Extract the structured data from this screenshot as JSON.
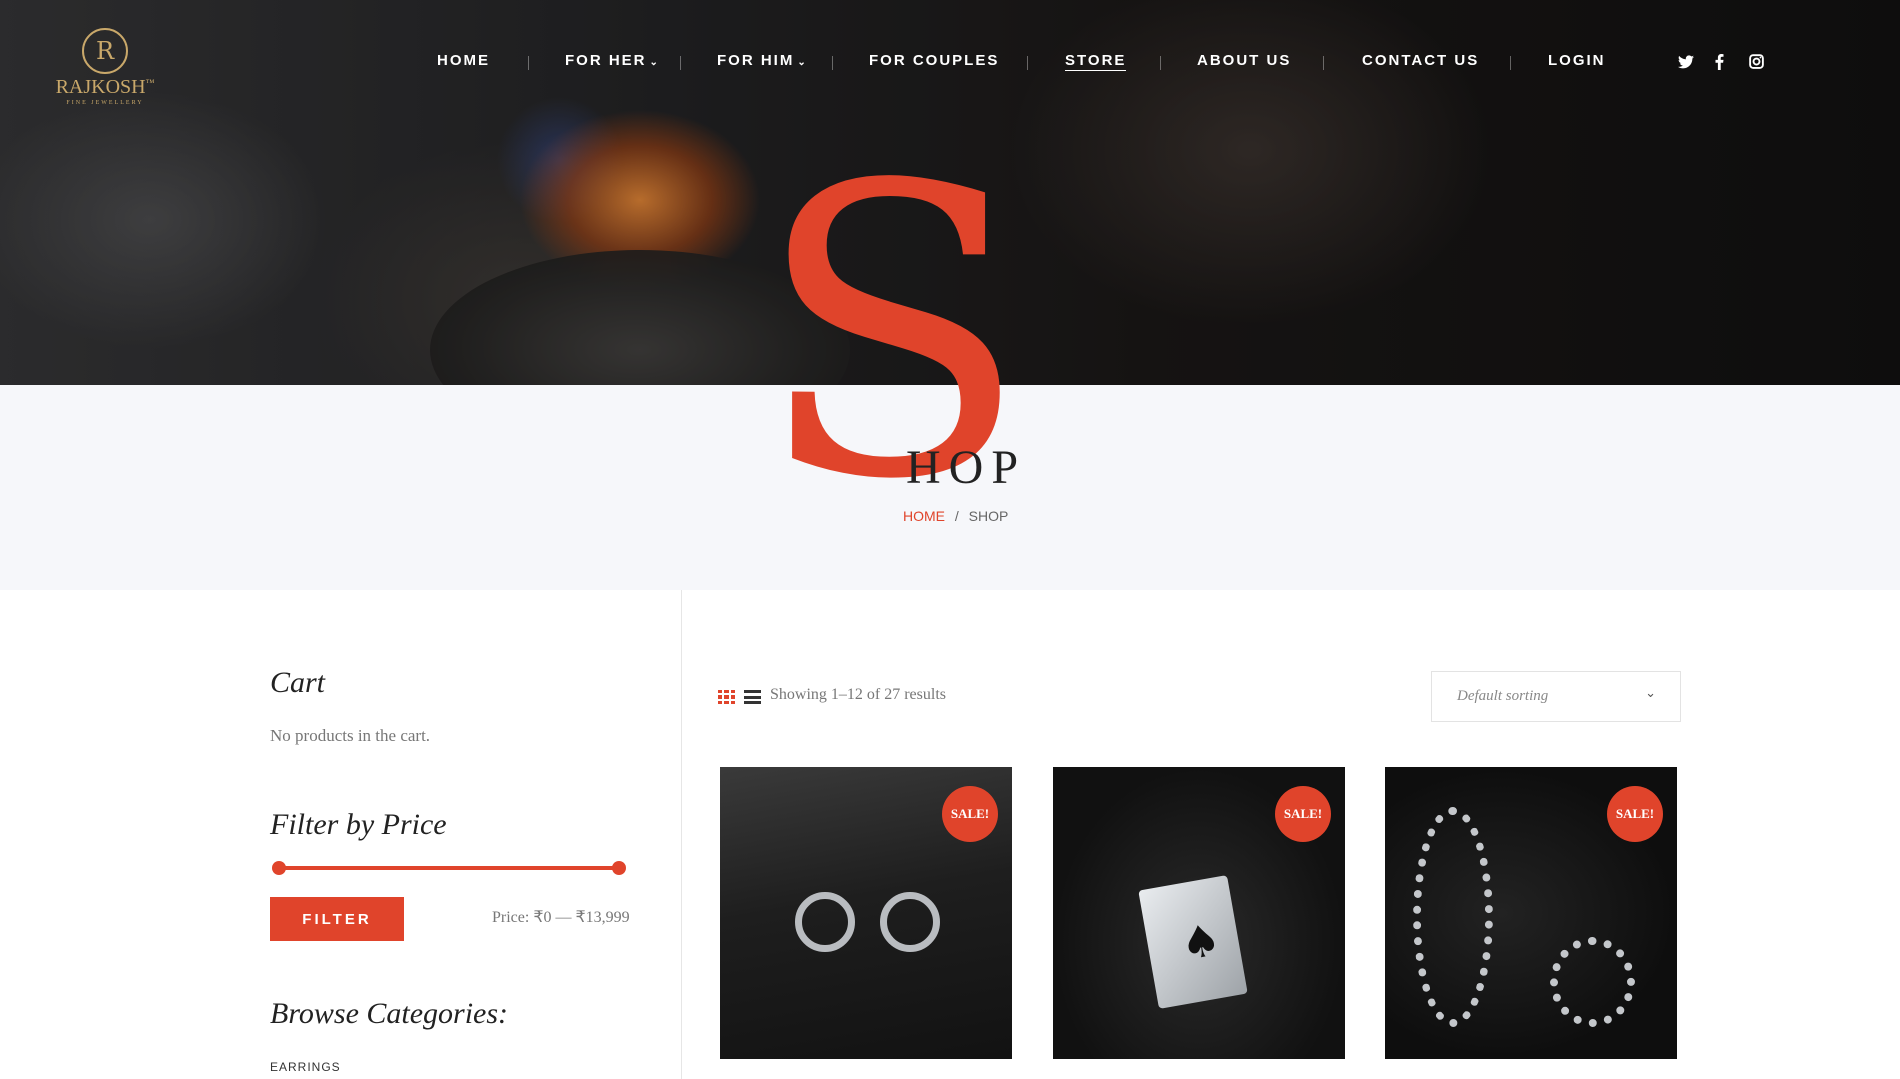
{
  "brand": {
    "name": "RAJKOSH",
    "mark": "R",
    "tm": "™",
    "tagline": "FINE JEWELLERY"
  },
  "nav": {
    "items": [
      {
        "label": "HOME"
      },
      {
        "label": "FOR HER",
        "dropdown": true
      },
      {
        "label": "FOR HIM",
        "dropdown": true
      },
      {
        "label": "FOR COUPLES"
      },
      {
        "label": "STORE",
        "active": true
      },
      {
        "label": "ABOUT US"
      },
      {
        "label": "CONTACT US"
      },
      {
        "label": "LOGIN"
      }
    ],
    "social": [
      "twitter-icon",
      "facebook-icon",
      "instagram-icon"
    ]
  },
  "page": {
    "title_initial": "S",
    "title_rest": "HOP",
    "breadcrumb": {
      "home": "HOME",
      "separator": "/",
      "current": "SHOP"
    }
  },
  "sidebar": {
    "cart": {
      "title": "Cart",
      "empty_text": "No products in the cart."
    },
    "price_filter": {
      "title": "Filter by Price",
      "button": "FILTER",
      "label": "Price: ₹0 — ₹13,999",
      "min": 0,
      "max": 13999
    },
    "categories": {
      "title": "Browse Categories:",
      "items": [
        "EARRINGS"
      ]
    }
  },
  "toolbar": {
    "view_modes": [
      "grid-view-icon",
      "list-view-icon"
    ],
    "active_view": "grid",
    "results_text": "Showing 1–12 of 27 results",
    "sort": {
      "selected": "Default sorting"
    }
  },
  "products": [
    {
      "badge": "SALE!",
      "image": "silver hoop earrings"
    },
    {
      "badge": "SALE!",
      "image": "playing cards pendant"
    },
    {
      "badge": "SALE!",
      "image": "silver rings"
    }
  ],
  "colors": {
    "accent": "#e0442b",
    "dark": "#222222",
    "band": "#f6f7fa",
    "gold": "#c9a86a"
  }
}
